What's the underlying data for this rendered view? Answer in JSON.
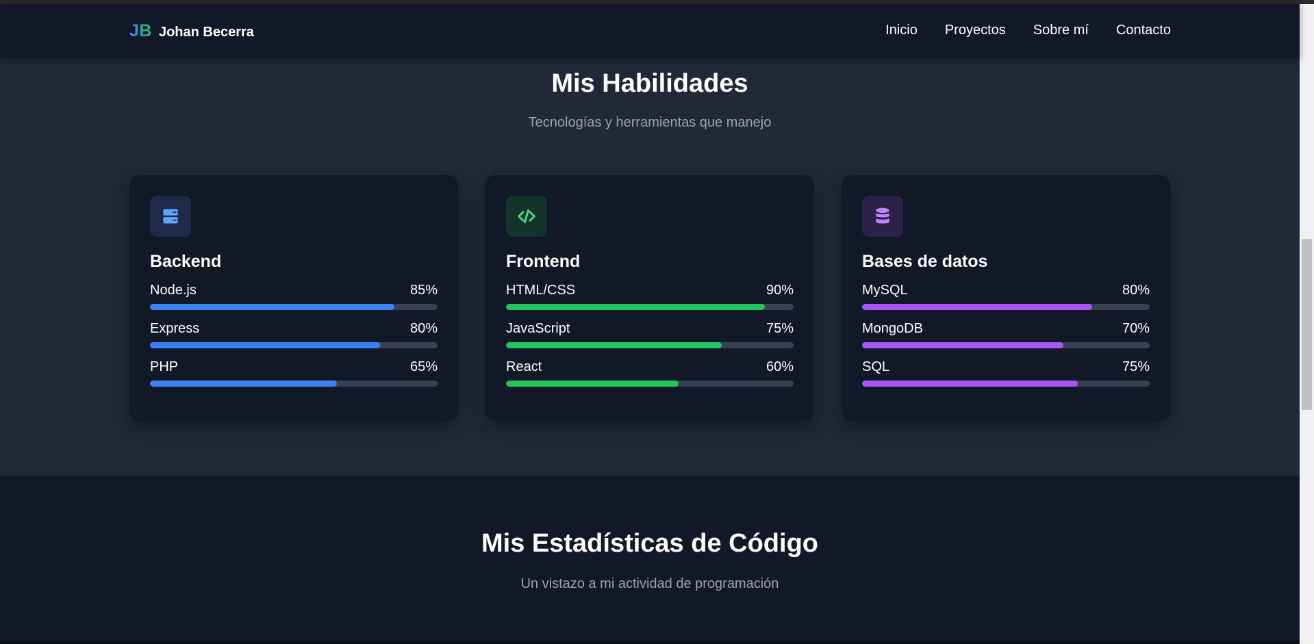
{
  "nav": {
    "logo": "JB",
    "name": "Johan Becerra",
    "links": [
      "Inicio",
      "Proyectos",
      "Sobre mí",
      "Contacto"
    ]
  },
  "skills": {
    "title": "Mis Habilidades",
    "subtitle": "Tecnologías y herramientas que manejo",
    "cards": [
      {
        "title": "Backend",
        "icon": "server-icon",
        "color": "#3b82f6",
        "icon_bg": "#1e2a47",
        "items": [
          {
            "name": "Node.js",
            "value": "85%",
            "level": 85
          },
          {
            "name": "Express",
            "value": "80%",
            "level": 80
          },
          {
            "name": "PHP",
            "value": "65%",
            "level": 65
          }
        ]
      },
      {
        "title": "Frontend",
        "icon": "code-icon",
        "color": "#22c55e",
        "icon_bg": "#14342b",
        "items": [
          {
            "name": "HTML/CSS",
            "value": "90%",
            "level": 90
          },
          {
            "name": "JavaScript",
            "value": "75%",
            "level": 75
          },
          {
            "name": "React",
            "value": "60%",
            "level": 60
          }
        ]
      },
      {
        "title": "Bases de datos",
        "icon": "database-icon",
        "color": "#a855f7",
        "icon_bg": "#2c2148",
        "items": [
          {
            "name": "MySQL",
            "value": "80%",
            "level": 80
          },
          {
            "name": "MongoDB",
            "value": "70%",
            "level": 70
          },
          {
            "name": "SQL",
            "value": "75%",
            "level": 75
          }
        ]
      }
    ]
  },
  "stats": {
    "title": "Mis Estadísticas de Código",
    "subtitle": "Un vistazo a mi actividad de programación"
  }
}
